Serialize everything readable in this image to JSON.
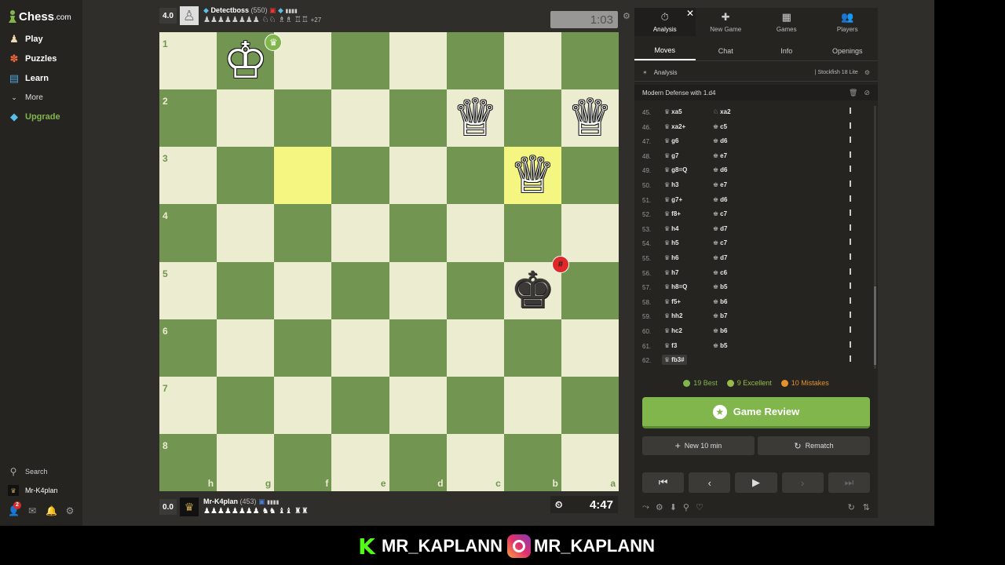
{
  "brand": {
    "name": "Chess",
    "suffix": ".com"
  },
  "nav": {
    "play": "Play",
    "puzzles": "Puzzles",
    "learn": "Learn",
    "more": "More",
    "upgrade": "Upgrade",
    "search": "Search",
    "user": "Mr-K4plan",
    "notifications": "2"
  },
  "top_player": {
    "score": "4.0",
    "name": "Detectboss",
    "rating": "(550)",
    "materials": "♟♟♟♟♟♟♟♟ ♘♘ ♗♗ ♖♖",
    "advantage": "+27",
    "clock": "1:03"
  },
  "bottom_player": {
    "score": "0.0",
    "name": "Mr-K4plan",
    "rating": "(453)",
    "materials": "♟♟♟♟♟♟♟♟ ♞♞ ♝♝ ♜♜",
    "clock": "4:47"
  },
  "board": {
    "ranks": [
      "1",
      "2",
      "3",
      "4",
      "5",
      "6",
      "7",
      "8"
    ],
    "files": [
      "h",
      "g",
      "f",
      "e",
      "d",
      "c",
      "b",
      "a"
    ],
    "pieces": [
      {
        "glyph": "♔",
        "color": "white",
        "col": 1,
        "row": 0
      },
      {
        "glyph": "♕",
        "color": "white",
        "col": 5,
        "row": 1
      },
      {
        "glyph": "♕",
        "color": "white",
        "col": 7,
        "row": 1
      },
      {
        "glyph": "♕",
        "color": "white",
        "col": 6,
        "row": 2
      },
      {
        "glyph": "♚",
        "color": "black",
        "col": 6,
        "row": 4
      }
    ],
    "highlights": [
      {
        "col": 2,
        "row": 2
      },
      {
        "col": 6,
        "row": 2
      }
    ],
    "winner_badge": "♛",
    "mate_badge": "#"
  },
  "panel": {
    "topnav": [
      {
        "icon": "⏱",
        "label": "Analysis"
      },
      {
        "icon": "✚",
        "label": "New Game"
      },
      {
        "icon": "▦",
        "label": "Games"
      },
      {
        "icon": "👥",
        "label": "Players"
      }
    ],
    "tabs": [
      "Moves",
      "Chat",
      "Info",
      "Openings"
    ],
    "analysis_label": "Analysis",
    "engine": "Stockfish 18 Lite",
    "opening": "Modern Defense with 1.d4",
    "moves": [
      {
        "n": "45.",
        "w": "xa5",
        "b": "xa2",
        "bsym": "♘"
      },
      {
        "n": "46.",
        "w": "xa2+",
        "b": "c5",
        "bsym": "♚"
      },
      {
        "n": "47.",
        "w": "g6",
        "b": "d6",
        "bsym": "♚"
      },
      {
        "n": "48.",
        "w": "g7",
        "b": "e7",
        "bsym": "♚"
      },
      {
        "n": "49.",
        "w": "g8=Q",
        "b": "d6",
        "bsym": "♚"
      },
      {
        "n": "50.",
        "w": "h3",
        "b": "e7",
        "bsym": "♚"
      },
      {
        "n": "51.",
        "w": "g7+",
        "b": "d6",
        "bsym": "♚"
      },
      {
        "n": "52.",
        "w": "f8+",
        "b": "c7",
        "bsym": "♚"
      },
      {
        "n": "53.",
        "w": "h4",
        "b": "d7",
        "bsym": "♚"
      },
      {
        "n": "54.",
        "w": "h5",
        "b": "c7",
        "bsym": "♚"
      },
      {
        "n": "55.",
        "w": "h6",
        "b": "d7",
        "bsym": "♚"
      },
      {
        "n": "56.",
        "w": "h7",
        "b": "c6",
        "bsym": "♚"
      },
      {
        "n": "57.",
        "w": "h8=Q",
        "b": "b5",
        "bsym": "♚"
      },
      {
        "n": "58.",
        "w": "f5+",
        "b": "b6",
        "bsym": "♚"
      },
      {
        "n": "59.",
        "w": "hh2",
        "b": "b7",
        "bsym": "♚"
      },
      {
        "n": "60.",
        "w": "hc2",
        "b": "b6",
        "bsym": "♚"
      },
      {
        "n": "61.",
        "w": "f3",
        "b": "b5",
        "bsym": "♚"
      },
      {
        "n": "62.",
        "w": "fb3#",
        "b": "",
        "bsym": ""
      }
    ],
    "summary": {
      "best": "19 Best",
      "excellent": "9 Excellent",
      "mistakes": "10 Mistakes"
    },
    "review": "Game Review",
    "new_game": "New 10 min",
    "rematch": "Rematch"
  },
  "social": {
    "kick": "MR_KAPLANN",
    "instagram": "MR_KAPLANN"
  },
  "colors": {
    "light_square": "#ebecd0",
    "dark_square": "#739552",
    "accent_green": "#81b64c",
    "best": "#81b64c",
    "excellent": "#96bc4b",
    "mistake": "#e6912c"
  }
}
